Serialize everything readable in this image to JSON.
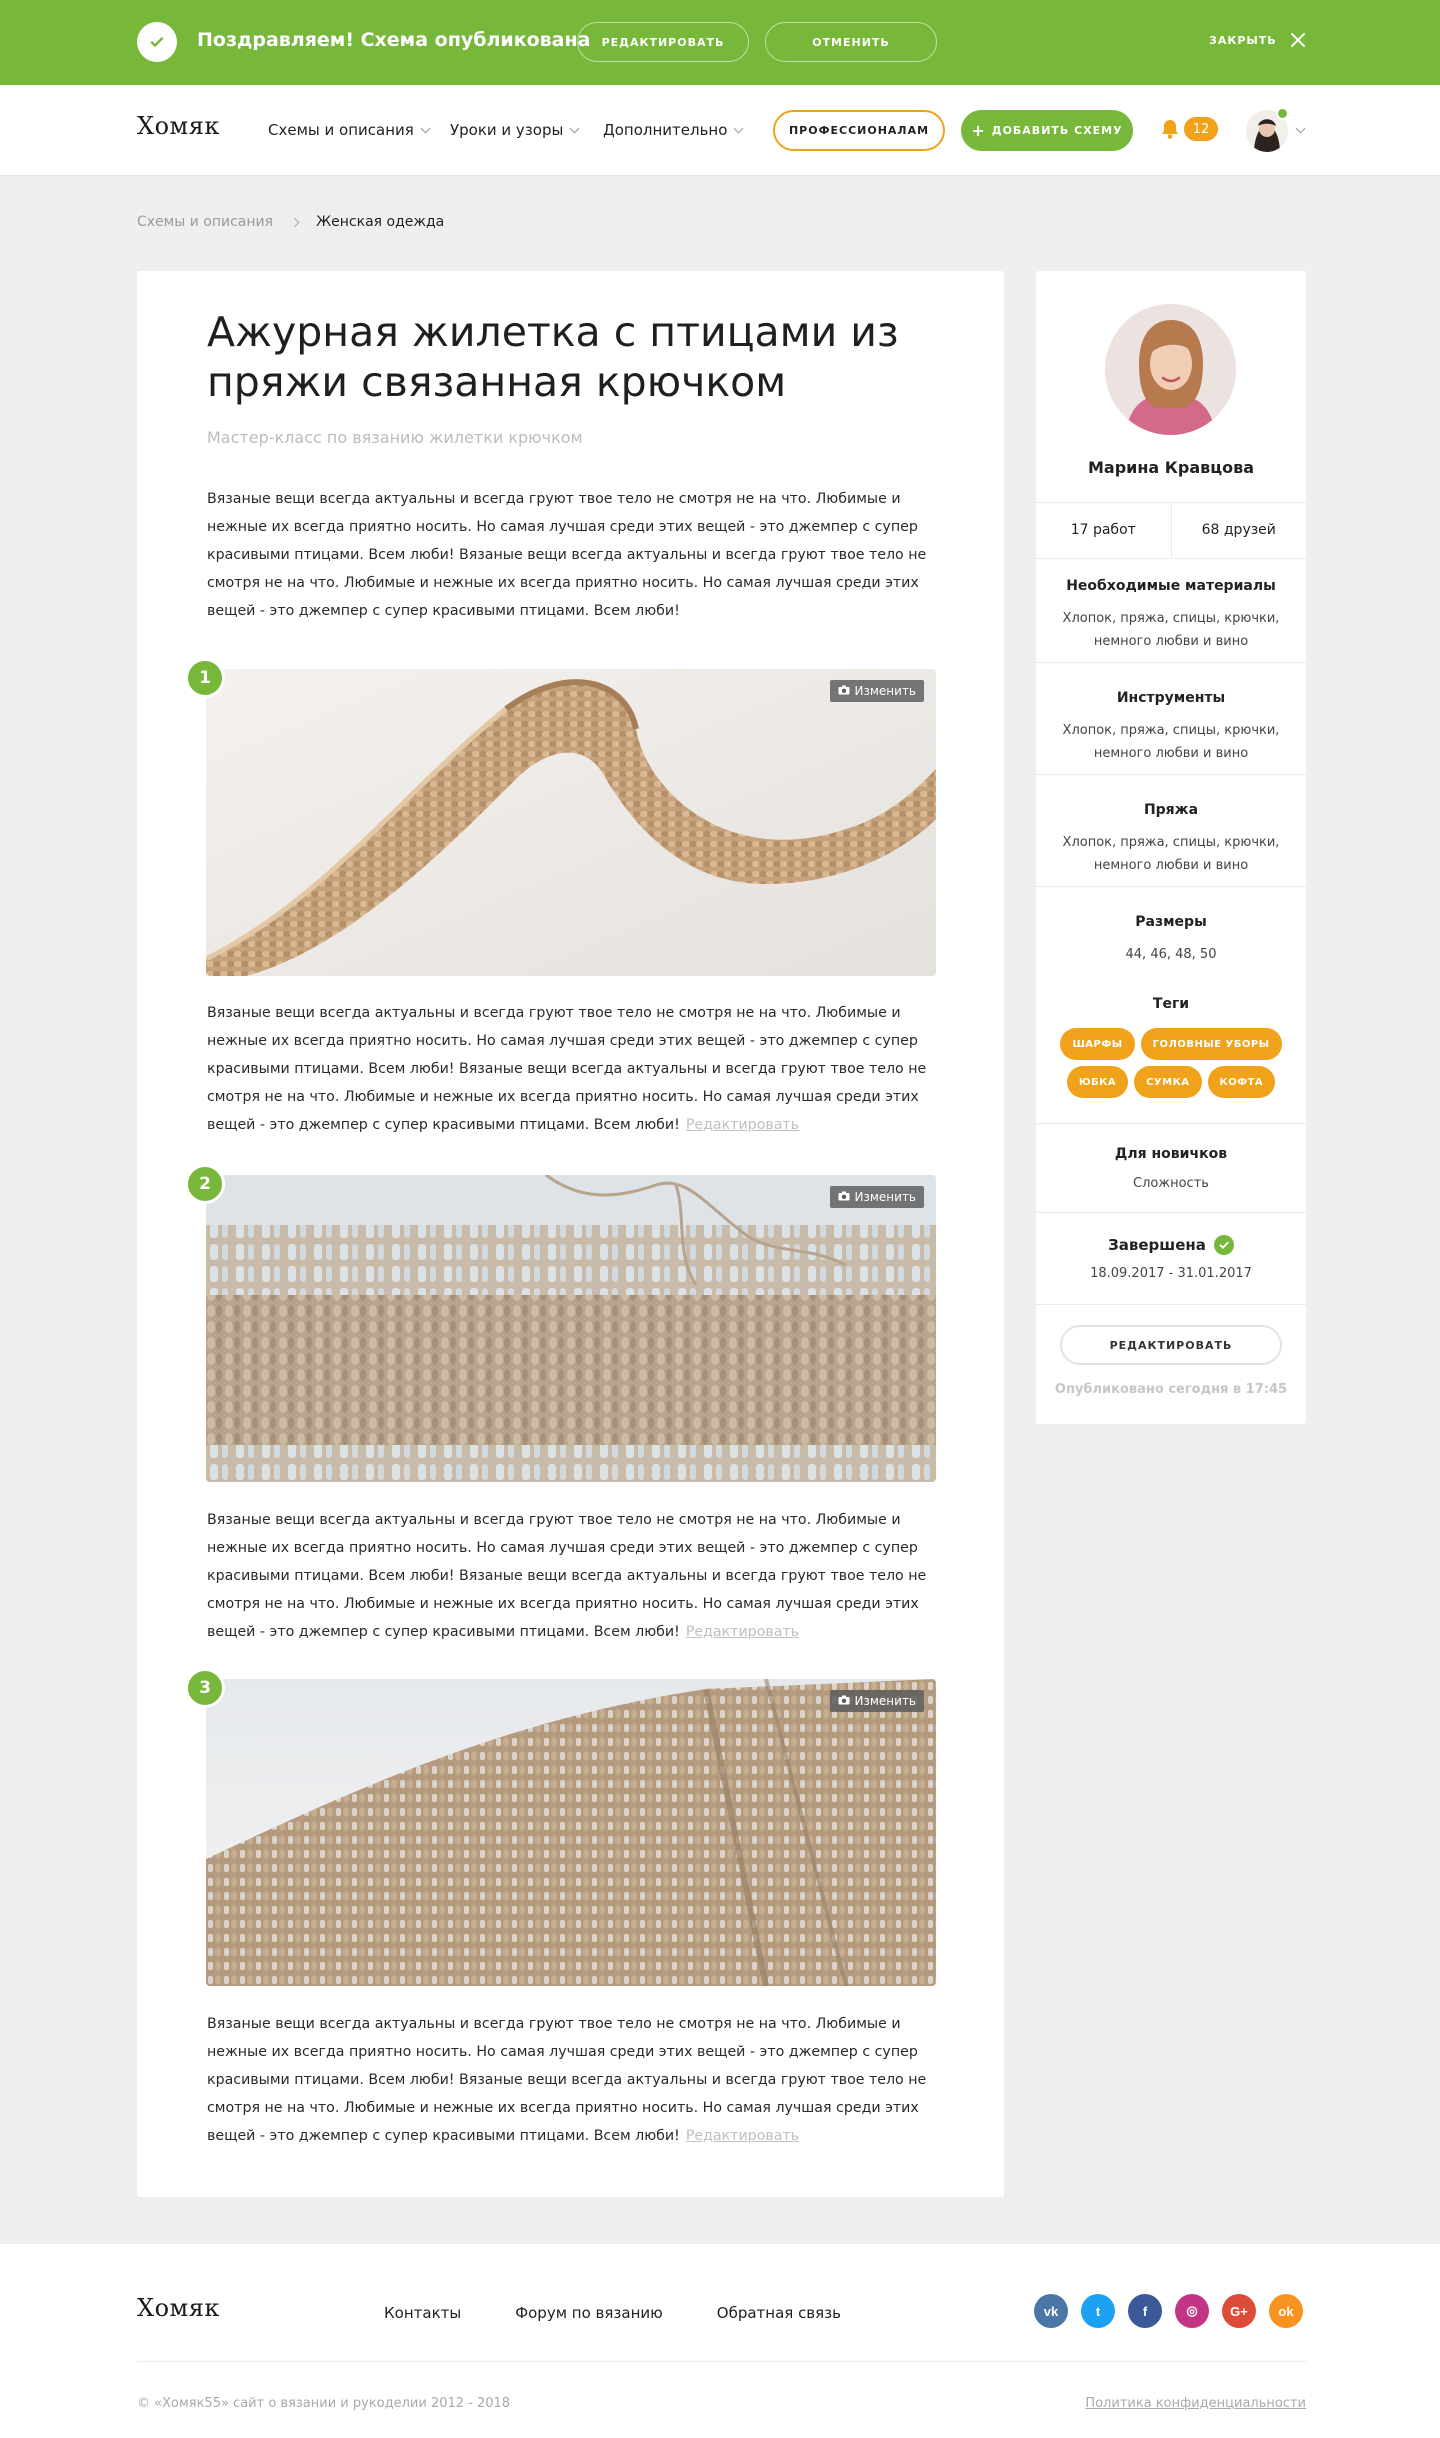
{
  "banner": {
    "message": "Поздравляем! Схема опубликована",
    "edit_label": "Редактировать",
    "cancel_label": "Отменить",
    "close_label": "Закрыть",
    "color": "#77b83a"
  },
  "header": {
    "logo": "Хомяк",
    "nav": [
      {
        "label": "Схемы и описания"
      },
      {
        "label": "Уроки и узоры"
      },
      {
        "label": "Дополнительно"
      }
    ],
    "pro_label": "Профессионалам",
    "add_label": "Добавить схему",
    "notifications": "12",
    "accent": "#f0a21b"
  },
  "breadcrumb": {
    "parent": "Схемы и описания",
    "current": "Женская одежда"
  },
  "article": {
    "title": "Ажурная жилетка с птицами из пряжи связанная крючком",
    "subtitle": "Мастер-класс по вязанию жилетки крючком",
    "intro": "Вязаные вещи всегда актуальны и всегда груют твое тело не смотря не на что. Любимые и нежные их всегда приятно носить. Но самая лучшая среди этих вещей - это  джемпер с супер красивыми птицами. Всем люби! Вязаные вещи всегда актуальны и всегда груют твое тело не смотря не на что. Любимые и нежные их всегда приятно носить. Но самая лучшая среди этих вещей - это джемпер с супер красивыми птицами. Всем люби!",
    "change_photo_label": "Изменить",
    "steps": [
      {
        "number": "1",
        "text": "Вязаные вещи всегда актуальны и всегда груют твое тело не смотря не на что. Любимые и нежные их всегда приятно носить. Но самая лучшая среди этих вещей - это  джемпер с супер красивыми птицами. Всем люби! Вязаные вещи всегда актуальны и всегда груют твое тело не смотря не на что. Любимые и нежные их всегда приятно носить. Но самая лучшая среди этих вещей - это джемпер с супер красивыми птицами. Всем люби!",
        "edit_label": "Редактировать"
      },
      {
        "number": "2",
        "text": "Вязаные вещи всегда актуальны и всегда груют твое тело не смотря не на что. Любимые и нежные их всегда приятно носить. Но самая лучшая среди этих вещей - это  джемпер с супер красивыми птицами. Всем люби! Вязаные вещи всегда актуальны и всегда груют твое тело не смотря не на что. Любимые и нежные их всегда приятно носить. Но самая лучшая среди этих вещей - это джемпер с супер красивыми птицами. Всем люби!",
        "edit_label": "Редактировать"
      },
      {
        "number": "3",
        "text": "Вязаные вещи всегда актуальны и всегда груют твое тело не смотря не на что. Любимые и нежные их всегда приятно носить. Но самая лучшая среди этих вещей - это  джемпер с супер красивыми птицами. Всем люби! Вязаные вещи всегда актуальны и всегда груют твое тело не смотря не на что. Любимые и нежные их всегда приятно носить. Но самая лучшая среди этих вещей - это джемпер с супер красивыми птицами. Всем люби!",
        "edit_label": "Редактировать"
      }
    ]
  },
  "sidebar": {
    "author": "Марина Кравцова",
    "works": "17 работ",
    "friends": "68 друзей",
    "materials_title": "Необходимые материалы",
    "materials_text": "Хлопок, пряжа, спицы, крючки, немного любви и вино",
    "tools_title": "Инструменты",
    "tools_text": "Хлопок, пряжа, спицы, крючки, немного любви и вино",
    "yarn_title": "Пряжа",
    "yarn_text": "Хлопок, пряжа, спицы, крючки, немного любви и вино",
    "sizes_title": "Размеры",
    "sizes_text": "44, 46, 48, 50",
    "tags_title": "Теги",
    "tags": [
      "Шарфы",
      "Головные уборы",
      "Юбка",
      "Сумка",
      "Кофта"
    ],
    "level_title": "Для новичков",
    "level_text": "Сложность",
    "done_title": "Завершена",
    "done_dates": "18.09.2017 - 31.01.2017",
    "edit_label": "Редактировать",
    "published": "Опубликовано сегодня в 17:45"
  },
  "footer": {
    "logo": "Хомяк",
    "links": [
      "Контакты",
      "Форум по вязанию",
      "Обратная связь"
    ],
    "socials": [
      {
        "name": "vk-icon",
        "glyph": "vk",
        "color": "#4a76a8"
      },
      {
        "name": "twitter-icon",
        "glyph": "t",
        "color": "#1da1f2"
      },
      {
        "name": "facebook-icon",
        "glyph": "f",
        "color": "#3b5998"
      },
      {
        "name": "instagram-icon",
        "glyph": "◎",
        "color": "#c13584"
      },
      {
        "name": "google-plus-icon",
        "glyph": "G+",
        "color": "#dd4b39"
      },
      {
        "name": "odnoklassniki-icon",
        "glyph": "ok",
        "color": "#f7931e"
      }
    ],
    "copyright": "© «Хомяк55» сайт о вязании и рукоделии 2012 - 2018",
    "privacy": "Политика конфиденциальности"
  }
}
